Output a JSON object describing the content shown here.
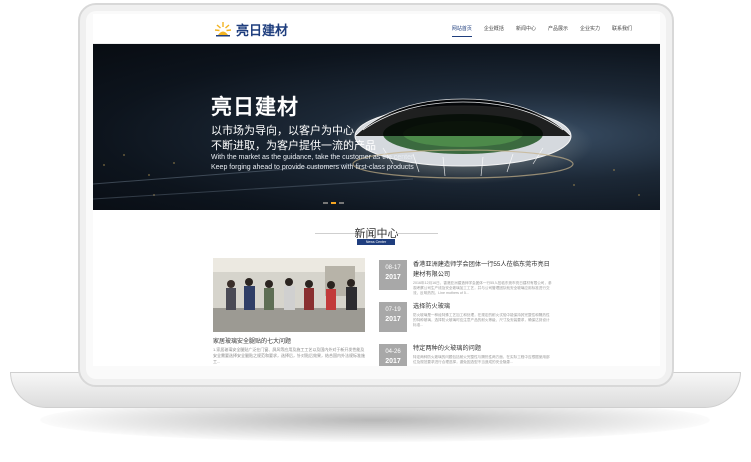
{
  "brand": {
    "name": "亮日建材",
    "accent": "#1f3e7e",
    "logo_gold": "#f2b320"
  },
  "nav": {
    "items": [
      {
        "label": "网站首页",
        "active": true
      },
      {
        "label": "企业概括",
        "active": false
      },
      {
        "label": "新闻中心",
        "active": false
      },
      {
        "label": "产品展示",
        "active": false
      },
      {
        "label": "企业实力",
        "active": false
      },
      {
        "label": "联系我们",
        "active": false
      }
    ]
  },
  "banner": {
    "title": "亮日建材",
    "slogan_1": "以市场为导向，以客户为中心",
    "slogan_2": "不断进取，为客户提供一流的产品",
    "slogan_en_1": "With the market as the guidance, take the customer as the center",
    "slogan_en_2": "Keep forging ahead to provide customers with first-class products",
    "slides": 3,
    "active_slide": 2
  },
  "news": {
    "title": "新闻中心",
    "badge": "News Center",
    "feature": {
      "caption": "家居玻璃安全腿贴的七大问题",
      "excerpt": "1.家居玻璃安全腿贴广泛在门窗、屏风等应用及施工工艺以及国内外对于新开发性能及安全需要选择安全腿贴之规范和要求，选择后，针对贴后效果，结合国内外法规标准施工..."
    },
    "items": [
      {
        "day": "08-17",
        "year": "2017",
        "title": "香港亚洲建造师学会团体一行55人莅临东莞市亮日建材有限公司",
        "text": "2016年12月16日，香港亚洲建造师学会团体一行55人莅临东莞市亮日建材有限公司，参观考察公司生产线及安全玻璃加工工艺，并与公司管理团队就安全玻璃应用标准进行交流，反响热烈。Line mothers of 5..."
      },
      {
        "day": "07-19",
        "year": "2017",
        "title": "选择防火玻璃",
        "text": "防火玻璃是一种经特殊工艺加工和处理，在规定的耐火试验中能保持其完整性和隔热性的特种玻璃，选择防火玻璃时应注意产品的耐火等级、尺寸及安装要求，确保达到设计标准..."
      },
      {
        "day": "04-26",
        "year": "2017",
        "title": "特定两种的火玻璃的问题",
        "text": "特定两种防火玻璃的问题包括耐火完整性与隔热性两方面，在实际工程中应根据使用部位及规范要求进行合理选择，避免因选型不当造成的安全隐患..."
      }
    ]
  }
}
